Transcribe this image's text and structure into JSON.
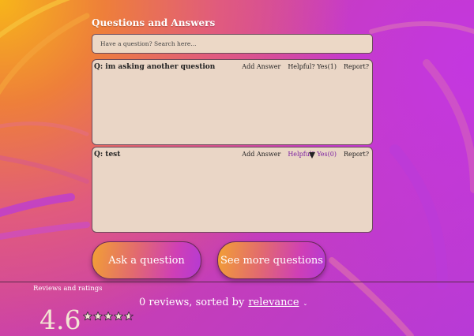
{
  "qa": {
    "title": "Questions and Answers",
    "search_placeholder": "Have a question? Search here...",
    "questions": [
      {
        "text": "Q: im asking another question",
        "add_answer": "Add Answer",
        "helpful": "Helpful? Yes(1)",
        "report": "Report?"
      },
      {
        "text": "Q: test",
        "add_answer": "Add Answer",
        "helpful": "Helpful? Yes(0)",
        "report": "Report?"
      }
    ],
    "ask_button": "Ask a question",
    "more_button": "See more questions"
  },
  "reviews": {
    "title": "Reviews and ratings",
    "sort_prefix": "0 reviews, sorted by",
    "sort_value": "relevance",
    "average": "4.6",
    "stars_out_of_five": 4.6
  },
  "colors": {
    "card": "#ead6c6",
    "accent_purple": "#7a1fa0",
    "button_start": "#f2a034",
    "button_end": "#b43ad4"
  },
  "icons": {
    "sort_chevron": "chevron-down-icon",
    "star": "star-icon"
  }
}
